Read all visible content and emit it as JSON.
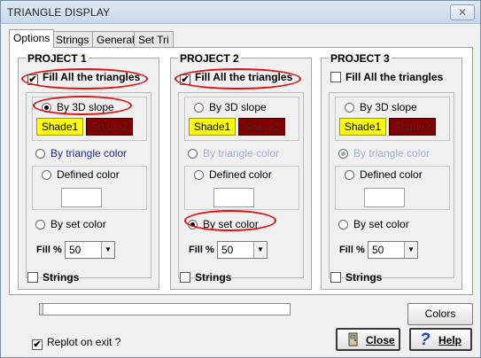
{
  "window": {
    "title": "TRIANGLE DISPLAY",
    "close_glyph": "✕"
  },
  "tabs": [
    "Options",
    "Strings",
    "General",
    "Set Tri Colors"
  ],
  "projects": [
    {
      "title": "PROJECT 1",
      "fill_all_label": "Fill All the triangles",
      "fill_all_checked": true,
      "by_slope_label": "By 3D slope",
      "shade1": "Shade1",
      "shade2": "Shade2",
      "by_tri_color_label": "By triangle color",
      "defined_color_label": "Defined color",
      "by_set_color_label": "By set color",
      "selected_mode": "by_slope",
      "fill_pct_label": "Fill %",
      "fill_pct_value": "50",
      "strings_label": "Strings",
      "strings_checked": false
    },
    {
      "title": "PROJECT 2",
      "fill_all_label": "Fill All the triangles",
      "fill_all_checked": true,
      "by_slope_label": "By 3D slope",
      "shade1": "Shade1",
      "shade2": "Shade2",
      "by_tri_color_label": "By triangle color",
      "defined_color_label": "Defined color",
      "by_set_color_label": "By set color",
      "selected_mode": "by_set_color",
      "fill_pct_label": "Fill %",
      "fill_pct_value": "50",
      "strings_label": "Strings",
      "strings_checked": false
    },
    {
      "title": "PROJECT 3",
      "fill_all_label": "Fill All the triangles",
      "fill_all_checked": false,
      "by_slope_label": "By 3D slope",
      "shade1": "Shade1",
      "shade2": "Shade2",
      "by_tri_color_label": "By triangle color",
      "defined_color_label": "Defined color",
      "by_set_color_label": "By set color",
      "selected_mode": "by_tri_color",
      "fill_pct_label": "Fill %",
      "fill_pct_value": "50",
      "strings_label": "Strings",
      "strings_checked": false
    }
  ],
  "bottom": {
    "colors_button": "Colors",
    "replot_label": "Replot on exit ?",
    "replot_checked": true,
    "close_button": "Close",
    "help_button": "Help"
  },
  "colors": {
    "shade1": "#ffff00",
    "shade2": "#800000",
    "highlight_oval": "#e01010"
  }
}
